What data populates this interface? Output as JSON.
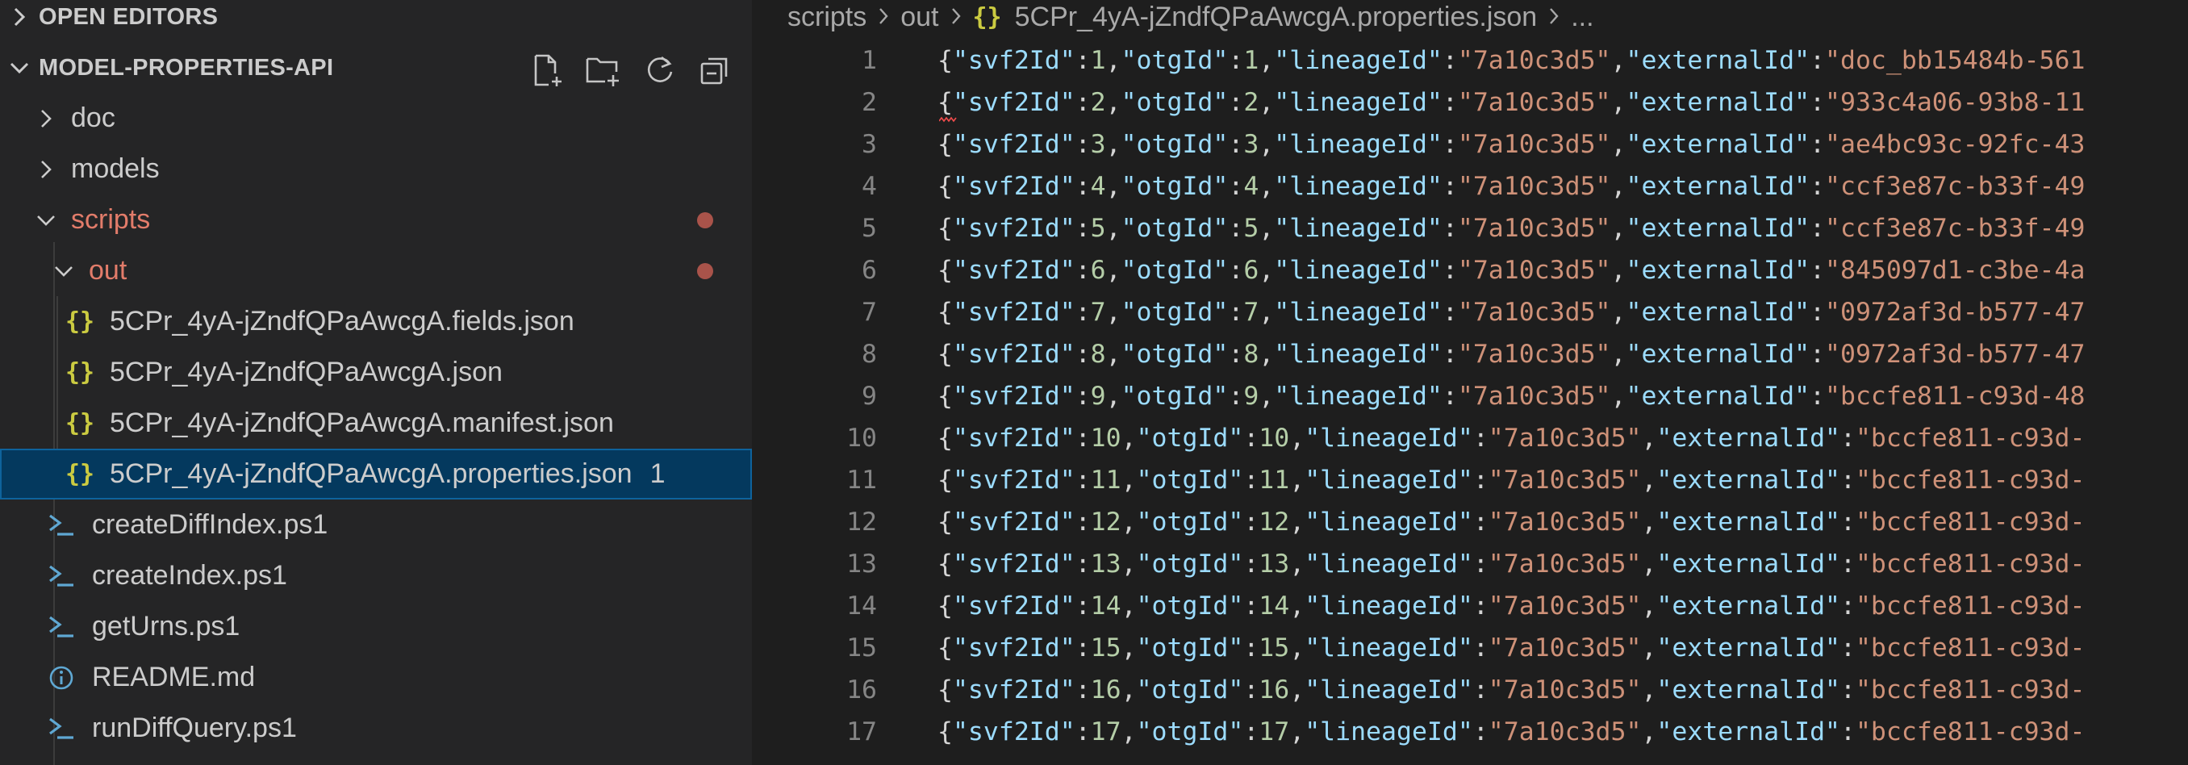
{
  "sidebar": {
    "open_editors_label": "OPEN EDITORS",
    "project_label": "MODEL-PROPERTIES-API",
    "tree": [
      {
        "label": "doc",
        "type": "folder",
        "expanded": false
      },
      {
        "label": "models",
        "type": "folder",
        "expanded": false
      },
      {
        "label": "scripts",
        "type": "folder",
        "expanded": true,
        "modified": true
      },
      {
        "label": "out",
        "type": "folder",
        "expanded": true,
        "modified": true
      },
      {
        "label": "5CPr_4yA-jZndfQPaAwcgA.fields.json",
        "type": "json"
      },
      {
        "label": "5CPr_4yA-jZndfQPaAwcgA.json",
        "type": "json"
      },
      {
        "label": "5CPr_4yA-jZndfQPaAwcgA.manifest.json",
        "type": "json"
      },
      {
        "label": "5CPr_4yA-jZndfQPaAwcgA.properties.json",
        "type": "json",
        "selected": true,
        "badge": "1"
      },
      {
        "label": "createDiffIndex.ps1",
        "type": "powershell"
      },
      {
        "label": "createIndex.ps1",
        "type": "powershell"
      },
      {
        "label": "getUrns.ps1",
        "type": "powershell"
      },
      {
        "label": "README.md",
        "type": "info"
      },
      {
        "label": "runDiffQuery.ps1",
        "type": "powershell"
      }
    ]
  },
  "breadcrumbs": {
    "items": [
      "scripts",
      "out",
      "5CPr_4yA-jZndfQPaAwcgA.properties.json",
      "..."
    ],
    "json_icon": "{}"
  },
  "editor": {
    "lines": [
      {
        "n": "1",
        "svf2Id": "1",
        "otgId": "1",
        "lineageId": "\"7a10c3d5\"",
        "externalId": "\"doc_bb15484b-561"
      },
      {
        "n": "2",
        "svf2Id": "2",
        "otgId": "2",
        "lineageId": "\"7a10c3d5\"",
        "externalId": "\"933c4a06-93b8-11"
      },
      {
        "n": "3",
        "svf2Id": "3",
        "otgId": "3",
        "lineageId": "\"7a10c3d5\"",
        "externalId": "\"ae4bc93c-92fc-43"
      },
      {
        "n": "4",
        "svf2Id": "4",
        "otgId": "4",
        "lineageId": "\"7a10c3d5\"",
        "externalId": "\"ccf3e87c-b33f-49"
      },
      {
        "n": "5",
        "svf2Id": "5",
        "otgId": "5",
        "lineageId": "\"7a10c3d5\"",
        "externalId": "\"ccf3e87c-b33f-49"
      },
      {
        "n": "6",
        "svf2Id": "6",
        "otgId": "6",
        "lineageId": "\"7a10c3d5\"",
        "externalId": "\"845097d1-c3be-4a"
      },
      {
        "n": "7",
        "svf2Id": "7",
        "otgId": "7",
        "lineageId": "\"7a10c3d5\"",
        "externalId": "\"0972af3d-b577-47"
      },
      {
        "n": "8",
        "svf2Id": "8",
        "otgId": "8",
        "lineageId": "\"7a10c3d5\"",
        "externalId": "\"0972af3d-b577-47"
      },
      {
        "n": "9",
        "svf2Id": "9",
        "otgId": "9",
        "lineageId": "\"7a10c3d5\"",
        "externalId": "\"bccfe811-c93d-48"
      },
      {
        "n": "10",
        "svf2Id": "10",
        "otgId": "10",
        "lineageId": "\"7a10c3d5\"",
        "externalId": "\"bccfe811-c93d-"
      },
      {
        "n": "11",
        "svf2Id": "11",
        "otgId": "11",
        "lineageId": "\"7a10c3d5\"",
        "externalId": "\"bccfe811-c93d-"
      },
      {
        "n": "12",
        "svf2Id": "12",
        "otgId": "12",
        "lineageId": "\"7a10c3d5\"",
        "externalId": "\"bccfe811-c93d-"
      },
      {
        "n": "13",
        "svf2Id": "13",
        "otgId": "13",
        "lineageId": "\"7a10c3d5\"",
        "externalId": "\"bccfe811-c93d-"
      },
      {
        "n": "14",
        "svf2Id": "14",
        "otgId": "14",
        "lineageId": "\"7a10c3d5\"",
        "externalId": "\"bccfe811-c93d-"
      },
      {
        "n": "15",
        "svf2Id": "15",
        "otgId": "15",
        "lineageId": "\"7a10c3d5\"",
        "externalId": "\"bccfe811-c93d-"
      },
      {
        "n": "16",
        "svf2Id": "16",
        "otgId": "16",
        "lineageId": "\"7a10c3d5\"",
        "externalId": "\"bccfe811-c93d-"
      },
      {
        "n": "17",
        "svf2Id": "17",
        "otgId": "17",
        "lineageId": "\"7a10c3d5\"",
        "externalId": "\"bccfe811-c93d-"
      }
    ]
  },
  "colors": {
    "sidebar_bg": "#252526",
    "editor_bg": "#1e1e1e",
    "selection_bg": "#04395e",
    "modified_text": "#e27c6a",
    "json_key": "#9cdcfe",
    "json_string": "#ce9178",
    "json_number": "#b5cea8",
    "json_icon": "#cbcb41"
  }
}
